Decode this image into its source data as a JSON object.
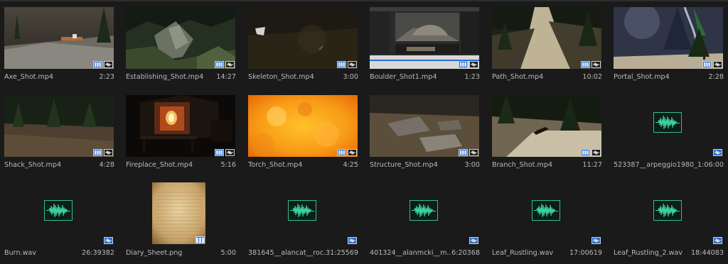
{
  "items": [
    {
      "name": "Axe_Shot.mp4",
      "duration": "2:23",
      "kind": "video",
      "thumb": "axe"
    },
    {
      "name": "Establishing_Shot.mp4",
      "duration": "14:27",
      "kind": "video",
      "thumb": "establishing"
    },
    {
      "name": "Skeleton_Shot.mp4",
      "duration": "3:00",
      "kind": "video",
      "thumb": "skeleton"
    },
    {
      "name": "Boulder_Shot1.mp4",
      "duration": "1:23",
      "kind": "video",
      "thumb": "boulder"
    },
    {
      "name": "Path_Shot.mp4",
      "duration": "10:02",
      "kind": "video",
      "thumb": "path"
    },
    {
      "name": "Portal_Shot.mp4",
      "duration": "2:28",
      "kind": "video",
      "thumb": "portal"
    },
    {
      "name": "Shack_Shot.mp4",
      "duration": "4:28",
      "kind": "video",
      "thumb": "shack"
    },
    {
      "name": "Fireplace_Shot.mp4",
      "duration": "5:16",
      "kind": "video",
      "thumb": "fireplace"
    },
    {
      "name": "Torch_Shot.mp4",
      "duration": "4:25",
      "kind": "video",
      "thumb": "torch"
    },
    {
      "name": "Structure_Shot.mp4",
      "duration": "3:00",
      "kind": "video",
      "thumb": "structure"
    },
    {
      "name": "Branch_Shot.mp4",
      "duration": "11:27",
      "kind": "video",
      "thumb": "branch"
    },
    {
      "name": "523387__arpeggio1980_...",
      "duration": "1:06:00",
      "kind": "audio"
    },
    {
      "name": "Burn.wav",
      "duration": "26:39382",
      "kind": "audio"
    },
    {
      "name": "Diary_Sheet.png",
      "duration": "5:00",
      "kind": "image"
    },
    {
      "name": "381645__alancat__roc...",
      "duration": "31:25569",
      "kind": "audio"
    },
    {
      "name": "401324__alanmcki__m...",
      "duration": "6:20368",
      "kind": "audio"
    },
    {
      "name": "Leaf_Rustling.wav",
      "duration": "17:00619",
      "kind": "audio"
    },
    {
      "name": "Leaf_Rustling_2.wav",
      "duration": "18:44083",
      "kind": "audio"
    }
  ],
  "colors": {
    "background": "#1a1a1a",
    "video_badge": "#2a6fd0",
    "waveform": "#2fbf8d",
    "label_text": "#b9b9b9"
  },
  "icons": {
    "video_badge": "film-strip-icon",
    "audio_badge": "audio-waveform-icon",
    "audio_thumb": "audio-waveform-icon"
  }
}
